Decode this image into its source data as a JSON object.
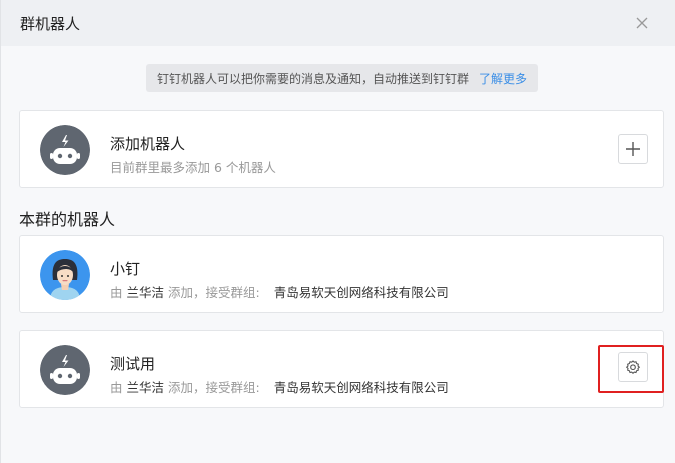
{
  "dialog": {
    "title": "群机器人",
    "close_icon": "close-icon"
  },
  "notice": {
    "text": "钉钉机器人可以把你需要的消息及通知，自动推送到钉钉群",
    "link": "了解更多"
  },
  "add_robot": {
    "name": "添加机器人",
    "subtitle": "目前群里最多添加 6 个机器人",
    "icon": "robot-icon",
    "button_icon": "plus-icon"
  },
  "section": {
    "title": "本群的机器人"
  },
  "robots": [
    {
      "name": "小钉",
      "by": "由",
      "author": "兰华洁",
      "action": "添加，接受群组:",
      "org": "青岛易软天创网络科技有限公司",
      "avatar": "assistant-avatar"
    },
    {
      "name": "测试用",
      "by": "由",
      "author": "兰华洁",
      "action": "添加，接受群组:",
      "org": "青岛易软天创网络科技有限公司",
      "avatar": "robot-icon",
      "button_icon": "gear-icon"
    }
  ],
  "colors": {
    "link": "#3a8ee6",
    "highlight": "#e02020",
    "robot_avatar": "#5f6670"
  }
}
